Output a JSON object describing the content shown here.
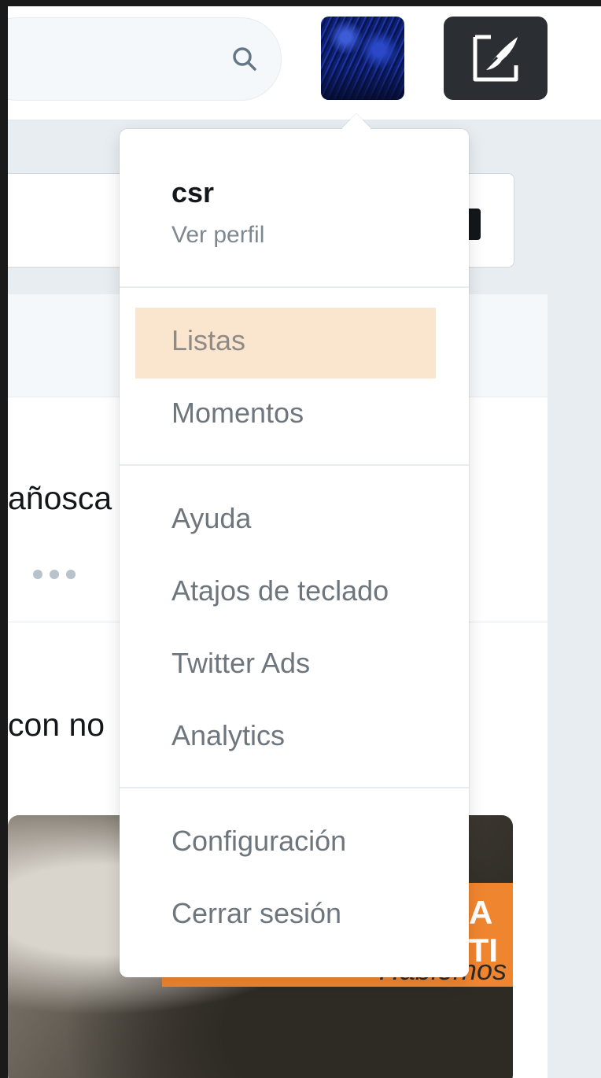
{
  "colors": {
    "compose_bg": "#2b2f33",
    "highlight": "#fae6cf",
    "banner": "#f0852f"
  },
  "header": {
    "search_icon": "search-icon",
    "avatar_alt": "user-avatar",
    "compose_icon": "compose-tweet-icon"
  },
  "background": {
    "tweet1_fragment": "añosca",
    "tweet2_fragment": "con no",
    "media_text_line1": "A",
    "media_text_line2": "E TI",
    "media_italic": "Hablemos"
  },
  "menu": {
    "username": "csr",
    "view_profile": "Ver perfil",
    "items_group1": [
      "Listas",
      "Momentos"
    ],
    "items_group2": [
      "Ayuda",
      "Atajos de teclado",
      "Twitter Ads",
      "Analytics"
    ],
    "items_group3": [
      "Configuración",
      "Cerrar sesión"
    ],
    "highlighted": "Listas"
  }
}
